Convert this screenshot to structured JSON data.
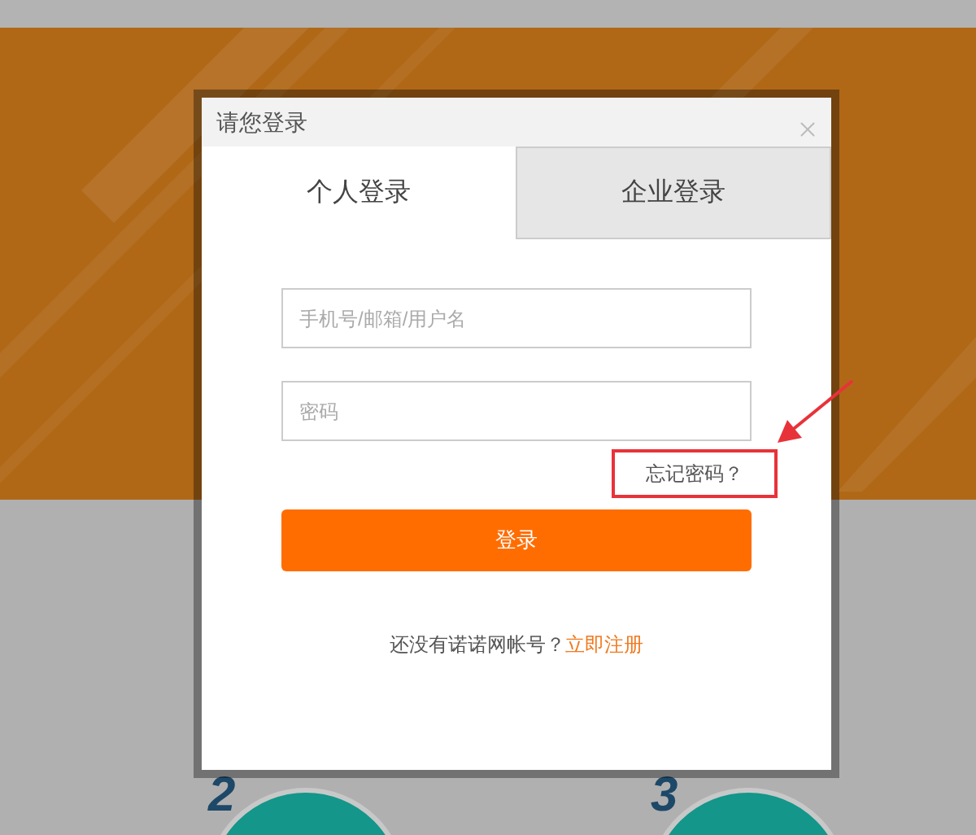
{
  "dialog": {
    "title": "请您登录",
    "tabs": [
      {
        "label": "个人登录",
        "selected": true
      },
      {
        "label": "企业登录",
        "selected": false
      }
    ],
    "fields": [
      {
        "placeholder": "手机号/邮箱/用户名"
      },
      {
        "placeholder": "密码"
      }
    ],
    "forgot_link": {
      "label": "忘记密码？",
      "highlighted": true
    },
    "login_button": "登录",
    "register": {
      "prompt": "还没有诺诺网帐号？",
      "link": "立即注册"
    }
  },
  "background": {
    "steps": [
      {
        "number": "2"
      },
      {
        "number": "3"
      }
    ]
  }
}
